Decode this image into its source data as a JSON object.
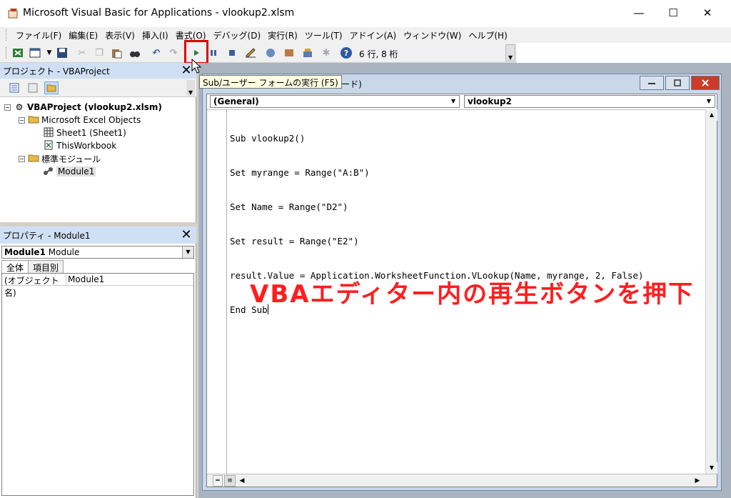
{
  "window": {
    "title": "Microsoft Visual Basic for Applications - vlookup2.xlsm",
    "minimize": "—",
    "maximize": "☐",
    "close": "✕"
  },
  "menu": {
    "items": [
      "ファイル(F)",
      "編集(E)",
      "表示(V)",
      "挿入(I)",
      "書式(O)",
      "デバッグ(D)",
      "実行(R)",
      "ツール(T)",
      "アドイン(A)",
      "ウィンドウ(W)",
      "ヘルプ(H)"
    ]
  },
  "toolbar": {
    "cursor_position": "6 行, 8 桁",
    "run_tooltip": "Sub/ユーザー フォームの実行 (F5)"
  },
  "project": {
    "title": "プロジェクト - VBAProject",
    "close": "✕",
    "tree": {
      "root": "VBAProject (vlookup2.xlsm)",
      "excel_objects": "Microsoft Excel Objects",
      "sheet1": "Sheet1 (Sheet1)",
      "thisworkbook": "ThisWorkbook",
      "std_modules": "標準モジュール",
      "module1": "Module1"
    }
  },
  "properties": {
    "title": "プロパティ - Module1",
    "close": "✕",
    "object_name": "Module1",
    "object_type": "Module",
    "tabs": [
      "全体",
      "項目別"
    ],
    "row_key": "(オブジェクト名)",
    "row_value": "Module1"
  },
  "code_window": {
    "title_fragment": "1 (コード)",
    "object_combo": "(General)",
    "proc_combo": "vlookup2",
    "lines": [
      "Sub vlookup2()",
      "Set myrange = Range(\"A:B\")",
      "Set Name = Range(\"D2\")",
      "Set result = Range(\"E2\")",
      "result.Value = Application.WorksheetFunction.VLookup(Name, myrange, 2, False)",
      "End Sub"
    ],
    "annotation": "VBAエディター内の再生ボタンを押下"
  },
  "colors": {
    "annotation": "#ff1e1e",
    "highlight_border": "#e00000",
    "pane_title_bg": "#cfe0f5",
    "mdi_bg": "#aab4c0"
  },
  "icons": {
    "run": "play-icon",
    "break": "pause-icon",
    "reset": "stop-icon",
    "help": "help-icon"
  }
}
